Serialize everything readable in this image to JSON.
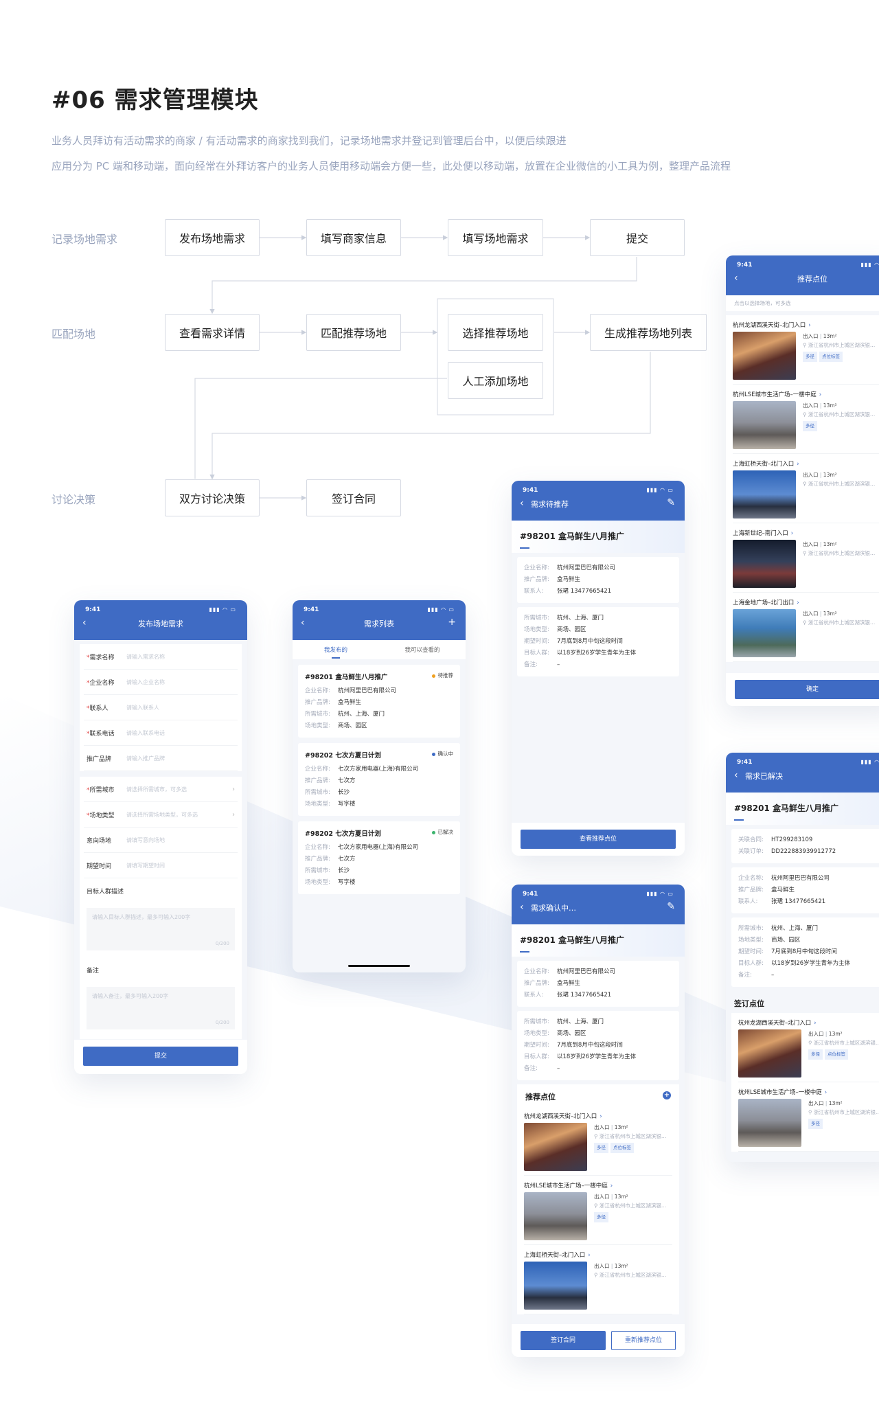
{
  "page": {
    "title": "#06 需求管理模块",
    "desc1": "业务人员拜访有活动需求的商家 / 有活动需求的商家找到我们，记录场地需求并登记到管理后台中，以便后续跟进",
    "desc2": "应用分为 PC 端和移动端，面向经常在外拜访客户的业务人员使用移动端会方便一些，此处便以移动端，放置在企业微信的小工具为例，整理产品流程"
  },
  "flow": {
    "lanes": [
      "记录场地需求",
      "匹配场地",
      "讨论决策"
    ],
    "row1": [
      "发布场地需求",
      "填写商家信息",
      "填写场地需求",
      "提交"
    ],
    "row2": [
      "查看需求详情",
      "匹配推荐场地",
      "选择推荐场地",
      "人工添加场地",
      "生成推荐场地列表"
    ],
    "row3": [
      "双方讨论决策",
      "签订合同"
    ]
  },
  "status_time": "9:41",
  "status_icons": "▮▮▮ ◠ ▭",
  "icons": {
    "back": "chevron-left-icon",
    "edit": "edit-icon",
    "add": "plus-icon",
    "pin": "location-pin-icon",
    "chevron": "chevron-right-icon"
  },
  "colors": {
    "primary": "#3f6bc4",
    "pending": "#f0a020",
    "confirming": "#3f6bc4",
    "solved": "#3cb46e"
  },
  "publish": {
    "nav_title": "发布场地需求",
    "group1": [
      {
        "label": "需求名称",
        "req": "*",
        "ph": "请输入需求名称"
      },
      {
        "label": "企业名称",
        "req": "*",
        "ph": "请输入企业名称"
      },
      {
        "label": "联系人",
        "req": "*",
        "ph": "请输入联系人"
      },
      {
        "label": "联系电话",
        "req": "*",
        "ph": "请输入联系电话"
      },
      {
        "label": "推广品牌",
        "req": "",
        "ph": "请输入推广品牌"
      }
    ],
    "group2": [
      {
        "label": "所需城市",
        "req": "*",
        "ph": "请选择所需城市，可多选",
        "chev": "›"
      },
      {
        "label": "场地类型",
        "req": "*",
        "ph": "请选择所需场地类型，可多选",
        "chev": "›"
      },
      {
        "label": "意向场地",
        "req": "",
        "ph": "请填写意向场地",
        "chev": ""
      },
      {
        "label": "期望时间",
        "req": "",
        "ph": "请填写期望时间",
        "chev": ""
      }
    ],
    "target_label": "目标人群描述",
    "target_ph": "请输入目标人群描述，最多可输入200字",
    "target_count": "0/200",
    "note_label": "备注",
    "note_ph": "请输入备注，最多可输入200字",
    "note_count": "0/200",
    "submit": "提交"
  },
  "list": {
    "nav_title": "需求列表",
    "add": "+",
    "tabs": [
      "我发布的",
      "我可以查看的"
    ],
    "keys": [
      "企业名称:",
      "推广品牌:",
      "所需城市:",
      "场地类型:"
    ],
    "items": [
      {
        "title": "#98201 盒马鲜生八月推广",
        "status": "待推荐",
        "color": "#f0a020",
        "vals": [
          "杭州阿里巴巴有限公司",
          "盒马鲜生",
          "杭州、上海、厦门",
          "商场、园区"
        ]
      },
      {
        "title": "#98202 七次方夏日计划",
        "status": "确认中",
        "color": "#3f6bc4",
        "vals": [
          "七次方家用电器(上海)有限公司",
          "七次方",
          "长沙",
          "写字楼"
        ]
      },
      {
        "title": "#98202 七次方夏日计划",
        "status": "已解决",
        "color": "#3cb46e",
        "vals": [
          "七次方家用电器(上海)有限公司",
          "七次方",
          "长沙",
          "写字楼"
        ]
      }
    ]
  },
  "detail": {
    "title": "#98201 盒马鲜生八月推广",
    "company_keys": [
      "企业名称:",
      "推广品牌:",
      "联系人:"
    ],
    "company_vals": [
      "杭州阿里巴巴有限公司",
      "盒马鲜生",
      "张珺 13477665421"
    ],
    "need_keys": [
      "所需城市:",
      "场地类型:",
      "期望时间:",
      "目标人群:",
      "备注:"
    ],
    "need_vals": [
      "杭州、上海、厦门",
      "商场、园区",
      "7月底到8月中旬这段时间",
      "以18岁到26岁学生青年为主体",
      "–"
    ]
  },
  "pending": {
    "nav_title": "需求待推荐",
    "button": "查看推荐点位"
  },
  "confirming": {
    "nav_title": "需求确认中…",
    "section": "推荐点位",
    "btn_contract": "签订合同",
    "btn_redo": "重新推荐点位"
  },
  "solved": {
    "nav_title": "需求已解决",
    "contract_keys": [
      "关联合同:",
      "关联订单:"
    ],
    "contract_vals": [
      "HT299283109",
      "DD222883939912772"
    ],
    "section": "签订点位"
  },
  "recommend": {
    "nav_title": "推荐点位",
    "hint": "点击以选择场地，可多选",
    "confirm": "确定"
  },
  "loc_entry": "出入口",
  "loc_area": "13m²",
  "loc_addr": "浙江省杭州市上城区湖滨银…",
  "locations": [
    {
      "name": "杭州龙湖西溪天街–北门入口",
      "tags": [
        "多径",
        "点位标签"
      ],
      "img": "t1"
    },
    {
      "name": "杭州LSE城市生活广场–一楼中庭",
      "tags": [
        "多径"
      ],
      "img": "t2"
    },
    {
      "name": "上海虹桥天街–北门入口",
      "tags": [],
      "img": "t3"
    },
    {
      "name": "上海新世纪–南门入口",
      "tags": [],
      "img": "t4"
    },
    {
      "name": "上海金地广场–北门出口",
      "tags": [],
      "img": "t5"
    }
  ]
}
